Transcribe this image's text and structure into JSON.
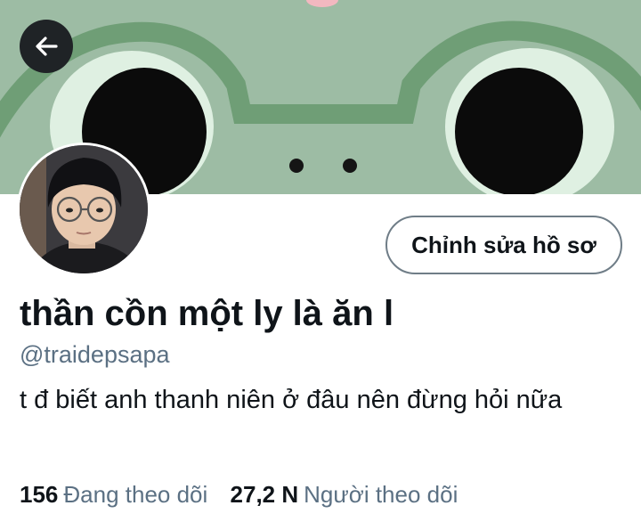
{
  "profile": {
    "display_name": "thần cồn một ly là ăn l",
    "handle": "@traidepsapa",
    "bio": "t đ biết anh thanh niên ở đâu nên đừng hỏi nữa",
    "edit_button_label": "Chỉnh sửa hồ sơ"
  },
  "stats": {
    "following_count": "156",
    "following_label": "Đang theo dõi",
    "followers_count": "27,2 N",
    "followers_label": "Người theo dõi"
  },
  "icons": {
    "back": "arrow-left-icon"
  },
  "colors": {
    "banner_bg": "#9dbca4",
    "banner_frog": "#6f9e76",
    "secondary_text": "#5b7083",
    "button_border": "#6f7d87"
  }
}
